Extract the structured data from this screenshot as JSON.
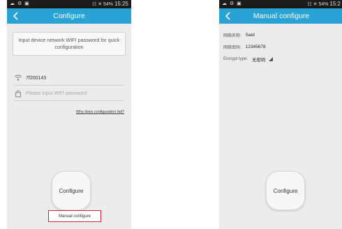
{
  "phone1": {
    "status": {
      "left_icons": "☁ ⚙ ▣",
      "right_icons": "☷ ✕ 54%",
      "time": "15:25"
    },
    "title": "Configure",
    "instruction": "Input device network WIFI password for quick configuration",
    "ssid": "7f200143",
    "password_placeholder": "Please input WIFI password",
    "help_link": "Why does configuration fail?",
    "configure_label": "Configure",
    "manual_label": "Manual configure",
    "highlight_color": "#d8203a"
  },
  "phone2": {
    "status": {
      "left_icons": "☁ ⚙ ▣",
      "right_icons": "☷ ✕ 54%",
      "time": "15:2"
    },
    "title": "Manual configure",
    "fields": [
      {
        "label": "网络名称:",
        "value": "Said"
      },
      {
        "label": "网络密码:",
        "value": "12345678"
      },
      {
        "label": "Encrypt type:",
        "value": "无密码"
      }
    ],
    "configure_label": "Configure"
  },
  "theme": {
    "titlebar": "#29a3d5",
    "background": "#ececec"
  }
}
